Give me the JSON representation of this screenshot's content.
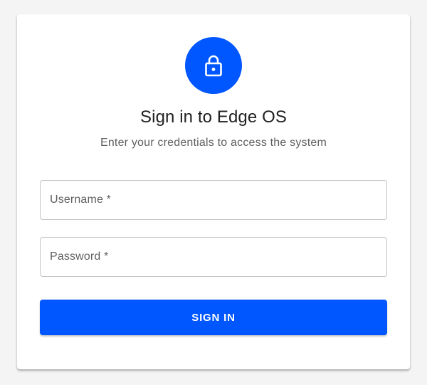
{
  "header": {
    "icon": "lock-icon",
    "title": "Sign in to Edge OS",
    "subtitle": "Enter your credentials to access the system"
  },
  "form": {
    "username": {
      "label": "Username *",
      "value": ""
    },
    "password": {
      "label": "Password *",
      "value": ""
    },
    "submit_label": "SIGN IN"
  },
  "colors": {
    "accent": "#0057ff",
    "background": "#f4f4f4",
    "card": "#ffffff"
  }
}
